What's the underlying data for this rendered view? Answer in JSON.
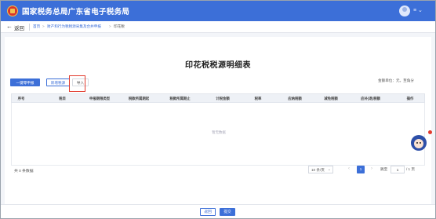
{
  "header": {
    "site_title": "国家税务总局广东省电子税务局",
    "user_menu_caret": "≡ ⌄"
  },
  "nav": {
    "back_label": "返回",
    "breadcrumb": [
      {
        "label": "首页",
        "type": "link"
      },
      {
        "label": "财产和行为税税源采集及合并申报",
        "type": "link"
      },
      {
        "label": "印花税",
        "type": "current"
      }
    ],
    "crumb_separator": ">"
  },
  "page": {
    "title": "印花税税源明细表",
    "unit_note": "金额单位：元，至角分"
  },
  "toolbar": {
    "one_click_label": "一键零申报",
    "add_label": "新增税源",
    "import_label": "导入"
  },
  "table": {
    "columns": [
      "序号",
      "税目",
      "申报期限类型",
      "税款所属期起",
      "税款所属期止",
      "计税金额",
      "税率",
      "应纳税额",
      "减免税额",
      "应补(退)税额",
      "操作"
    ],
    "empty_text": "暂无数据"
  },
  "pagination": {
    "total_text": "共 0 条数据",
    "page_size": "10 条/页",
    "page_size_caret": "⌄",
    "prev": "‹",
    "current_page": "1",
    "next": "›",
    "goto_label": "跳至",
    "goto_value": "1",
    "total_pages": "/ 1 页"
  },
  "footer": {
    "back_label": "返回",
    "submit_label": "提交"
  },
  "colors": {
    "brand_blue": "#3c6fd8",
    "highlight_red": "#e23b2e"
  }
}
